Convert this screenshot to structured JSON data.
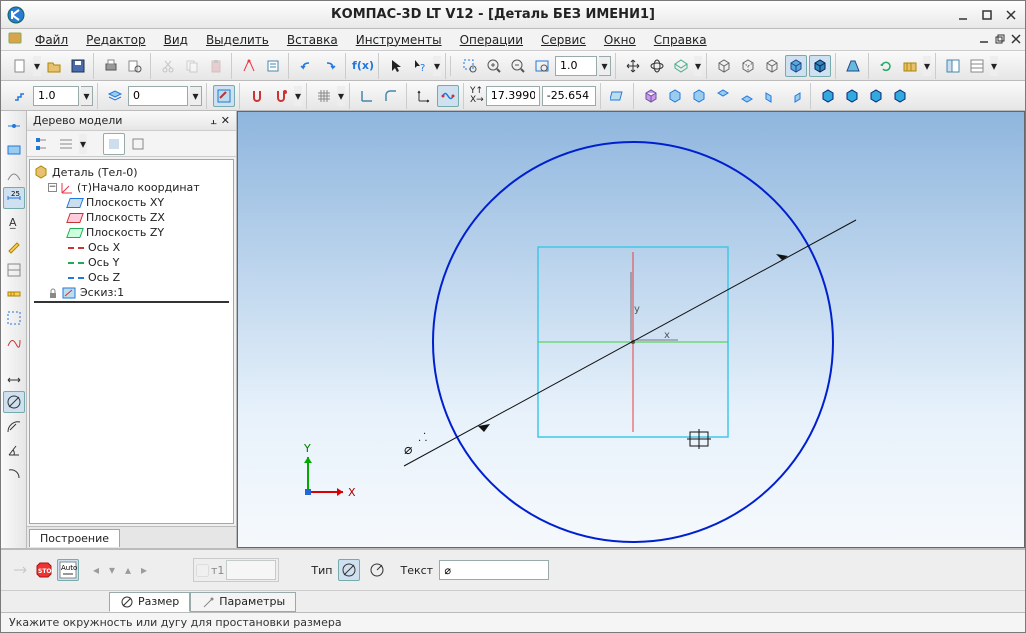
{
  "window": {
    "title": "КОМПАС-3D LT V12 - [Деталь БЕЗ ИМЕНИ1]"
  },
  "menu": {
    "file": "Файл",
    "editor": "Редактор",
    "view": "Вид",
    "select": "Выделить",
    "insert": "Вставка",
    "tools": "Инструменты",
    "operations": "Операции",
    "service": "Сервис",
    "window": "Окно",
    "help": "Справка"
  },
  "toolbar1": {
    "zoom_value": "1.0"
  },
  "toolbar2": {
    "field1": "1.0",
    "field2": "0",
    "coord_label": "Y↑X→",
    "coord_x": "17.3990",
    "coord_y": "-25.654"
  },
  "tree": {
    "panel_title": "Дерево модели",
    "root": "Деталь (Тел-0)",
    "origin": "(т)Начало координат",
    "plane_xy": "Плоскость XY",
    "plane_zx": "Плоскость ZX",
    "plane_zy": "Плоскость ZY",
    "axis_x": "Ось X",
    "axis_y": "Ось Y",
    "axis_z": "Ось Z",
    "sketch1": "Эскиз:1",
    "tab_build": "Построение"
  },
  "viewport": {
    "axis_x_label": "X",
    "axis_y_label": "Y",
    "mini_x": "X",
    "mini_y": "Y",
    "diameter_symbol": "⌀",
    "marker_x": "x",
    "marker_y": "y"
  },
  "props": {
    "t1_label": "т1",
    "type_label": "Тип",
    "text_label": "Текст",
    "text_value": "⌀"
  },
  "bottom_tabs": {
    "dimension": "Размер",
    "parameters": "Параметры"
  },
  "status": {
    "message": "Укажите окружность или дугу для простановки размера"
  }
}
